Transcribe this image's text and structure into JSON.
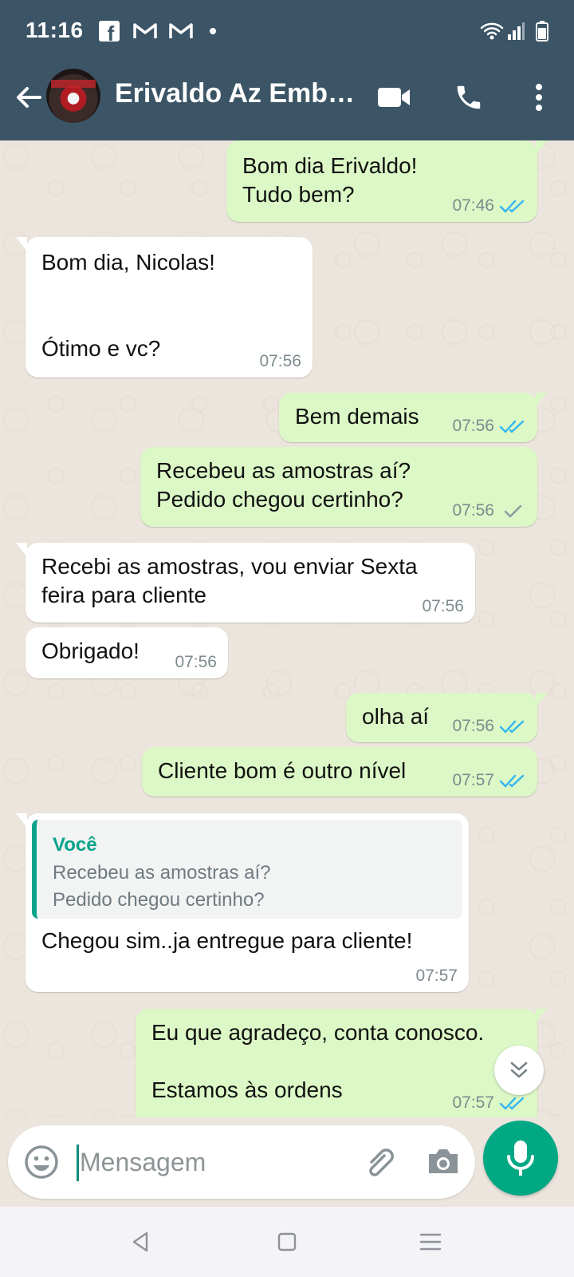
{
  "status_bar": {
    "time": "11:16",
    "fb_glyph": "f",
    "icons": [
      "facebook-icon",
      "gmail-icon",
      "gmail-icon",
      "dot-icon",
      "wifi-icon",
      "signal-icon",
      "battery-icon"
    ]
  },
  "header": {
    "contact_name": "Erivaldo Az Emb…",
    "icons": [
      "back-arrow-icon",
      "video-call-icon",
      "phone-call-icon",
      "more-vert-icon"
    ]
  },
  "messages": [
    {
      "dir": "out",
      "text": "Bom dia Erivaldo!\nTudo bem?",
      "time": "07:46",
      "status": "read"
    },
    {
      "dir": "in",
      "text": "Bom dia, Nicolas!\n\n\nÓtimo e vc?",
      "time": "07:56"
    },
    {
      "dir": "out",
      "text": "Bem demais",
      "time": "07:56",
      "status": "read"
    },
    {
      "dir": "out",
      "text": "Recebeu as amostras aí?\nPedido chegou certinho?",
      "time": "07:56",
      "status": "sent"
    },
    {
      "dir": "in",
      "text": "Recebi as amostras, vou enviar Sexta\nfeira para cliente",
      "time": "07:56"
    },
    {
      "dir": "in",
      "text": "Obrigado!",
      "time": "07:56"
    },
    {
      "dir": "out",
      "text": "olha aí",
      "time": "07:56",
      "status": "read"
    },
    {
      "dir": "out",
      "text": "Cliente bom é outro nível",
      "time": "07:57",
      "status": "read"
    },
    {
      "dir": "in",
      "quote_author": "Você",
      "quote_text": "Recebeu as amostras aí?\nPedido chegou certinho?",
      "text": "Chegou sim..ja entregue para cliente!",
      "time": "07:57"
    },
    {
      "dir": "out",
      "text": "Eu que agradeço, conta conosco.\n\nEstamos às ordens",
      "time": "07:57",
      "status": "read"
    }
  ],
  "input": {
    "placeholder": "Mensagem",
    "value": ""
  },
  "colors": {
    "header_bg": "#3c5566",
    "outgoing_bubble": "#dcf8c6",
    "incoming_bubble": "#ffffff",
    "chat_bg": "#ece5dd",
    "accent": "#00a884",
    "read_ticks": "#34b7f1"
  }
}
